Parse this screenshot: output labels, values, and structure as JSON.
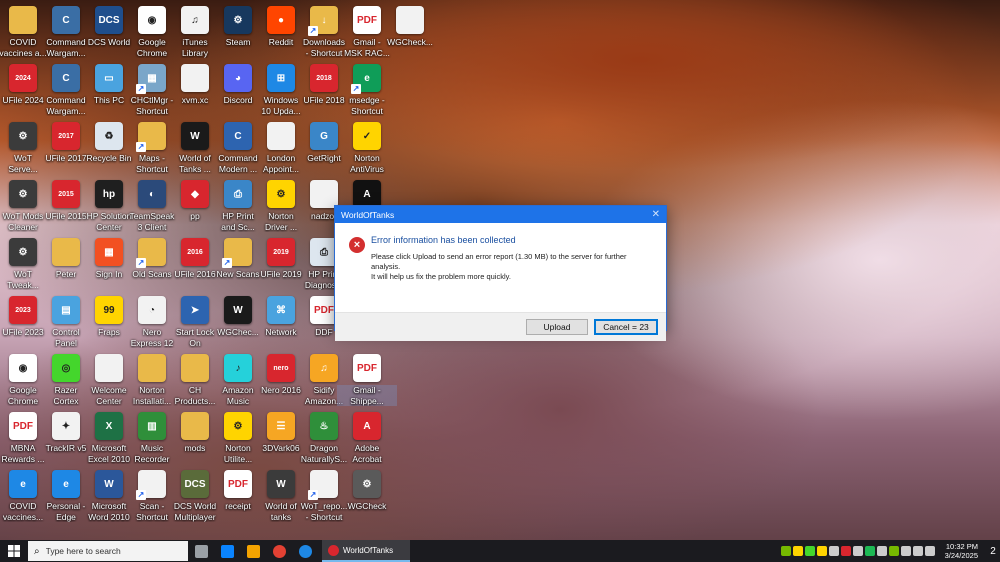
{
  "desktop_icons": [
    {
      "label": "COVID\nvaccines a...",
      "color": "#e9b949",
      "glyph": "",
      "shortcut": false,
      "icon": "folder-icon"
    },
    {
      "label": "Command\nWargam...",
      "color": "#3a6ea5",
      "glyph": "C",
      "shortcut": false,
      "icon": "command-app-icon"
    },
    {
      "label": "DCS World",
      "color": "#1f4e8c",
      "glyph": "DCS",
      "shortcut": false,
      "icon": "dcs-icon"
    },
    {
      "label": "Google\nChrome",
      "color": "#ffffff",
      "glyph": "◉",
      "shortcut": false,
      "icon": "chrome-icon"
    },
    {
      "label": "iTunes\nLibrary",
      "color": "#f2f2f2",
      "glyph": "♫",
      "shortcut": false,
      "icon": "itunes-file-icon"
    },
    {
      "label": "Steam",
      "color": "#17385e",
      "glyph": "⚙",
      "shortcut": false,
      "icon": "steam-icon"
    },
    {
      "label": "Reddit",
      "color": "#ff4500",
      "glyph": "●",
      "shortcut": false,
      "icon": "reddit-icon"
    },
    {
      "label": "Downloads\n- Shortcut",
      "color": "#e9b949",
      "glyph": "↓",
      "shortcut": true,
      "icon": "downloads-folder-icon"
    },
    {
      "label": "Gmail -\nMSK RAC...",
      "color": "#ffffff",
      "glyph": "PDF",
      "shortcut": false,
      "icon": "pdf-icon"
    },
    {
      "label": "WGCheck...",
      "color": "#f2f2f2",
      "glyph": "",
      "shortcut": false,
      "icon": "text-file-icon"
    },
    {
      "label": "UFile 2024",
      "color": "#d8262e",
      "glyph": "2024",
      "shortcut": false,
      "icon": "ufile-icon"
    },
    {
      "label": "Command\nWargam...",
      "color": "#3a6ea5",
      "glyph": "C",
      "shortcut": false,
      "icon": "command-app-icon"
    },
    {
      "label": "This PC",
      "color": "#4aa3df",
      "glyph": "▭",
      "shortcut": false,
      "icon": "computer-icon"
    },
    {
      "label": "CHCtlMgr -\nShortcut",
      "color": "#7aa6c9",
      "glyph": "▦",
      "shortcut": true,
      "icon": "chctlmgr-icon"
    },
    {
      "label": "xvm.xc",
      "color": "#f2f2f2",
      "glyph": "",
      "shortcut": false,
      "icon": "text-file-icon"
    },
    {
      "label": "Discord",
      "color": "#5865f2",
      "glyph": "◕",
      "shortcut": false,
      "icon": "discord-icon"
    },
    {
      "label": "Windows\n10 Upda...",
      "color": "#1e88e5",
      "glyph": "⊞",
      "shortcut": false,
      "icon": "windows-icon"
    },
    {
      "label": "UFile 2018",
      "color": "#d8262e",
      "glyph": "2018",
      "shortcut": false,
      "icon": "ufile-icon"
    },
    {
      "label": "msedge -\nShortcut",
      "color": "#0f9d58",
      "glyph": "e",
      "shortcut": true,
      "icon": "edge-icon"
    },
    {
      "label": "WoT\nServe...",
      "color": "#3b3b3b",
      "glyph": "⚙",
      "shortcut": false,
      "icon": "wot-icon"
    },
    {
      "label": "UFile 2017",
      "color": "#d8262e",
      "glyph": "2017",
      "shortcut": false,
      "icon": "ufile-icon"
    },
    {
      "label": "Recycle Bin",
      "color": "#dde6ef",
      "glyph": "♻",
      "shortcut": false,
      "icon": "recycle-bin-icon"
    },
    {
      "label": "Maps -\nShortcut",
      "color": "#e9b949",
      "glyph": "",
      "shortcut": true,
      "icon": "folder-icon"
    },
    {
      "label": "World of\nTanks ...",
      "color": "#1a1a1a",
      "glyph": "W",
      "shortcut": false,
      "icon": "wot-game-icon"
    },
    {
      "label": "Command\nModern ...",
      "color": "#2d64b0",
      "glyph": "C",
      "shortcut": false,
      "icon": "command-modern-icon"
    },
    {
      "label": "London\nAppoint...",
      "color": "#f2f2f2",
      "glyph": "",
      "shortcut": false,
      "icon": "text-file-icon"
    },
    {
      "label": "GetRight",
      "color": "#3a86c8",
      "glyph": "G",
      "shortcut": false,
      "icon": "getright-icon"
    },
    {
      "label": "Norton\nAntiVirus",
      "color": "#ffd400",
      "glyph": "✓",
      "shortcut": false,
      "icon": "norton-icon"
    },
    {
      "label": "WoT Mods\nCleaner",
      "color": "#3b3b3b",
      "glyph": "⚙",
      "shortcut": false,
      "icon": "wot-icon"
    },
    {
      "label": "UFile 2015",
      "color": "#d8262e",
      "glyph": "2015",
      "shortcut": false,
      "icon": "ufile-icon"
    },
    {
      "label": "HP Solution\nCenter",
      "color": "#1f1f1f",
      "glyph": "hp",
      "shortcut": false,
      "icon": "hp-icon"
    },
    {
      "label": "TeamSpeak\n3 Client",
      "color": "#2b4a7a",
      "glyph": "◐",
      "shortcut": false,
      "icon": "teamspeak-icon"
    },
    {
      "label": "pp",
      "color": "#d8262e",
      "glyph": "◆",
      "shortcut": false,
      "icon": "pp-icon"
    },
    {
      "label": "HP Print\nand Sc...",
      "color": "#3a86c8",
      "glyph": "⎙",
      "shortcut": false,
      "icon": "hp-print-icon"
    },
    {
      "label": "Norton\nDriver ...",
      "color": "#ffd400",
      "glyph": "⚙",
      "shortcut": false,
      "icon": "norton-driver-icon"
    },
    {
      "label": "nadzor",
      "color": "#f2f2f2",
      "glyph": "",
      "shortcut": false,
      "icon": "text-file-icon"
    },
    {
      "label": "",
      "color": "#111111",
      "glyph": "A",
      "shortcut": false,
      "icon": "slain-icon"
    },
    {
      "label": "WoT\nTweak...",
      "color": "#3b3b3b",
      "glyph": "⚙",
      "shortcut": false,
      "icon": "wot-icon"
    },
    {
      "label": "Peter",
      "color": "#e9b949",
      "glyph": "",
      "shortcut": false,
      "icon": "folder-icon"
    },
    {
      "label": "Sign In",
      "color": "#f25022",
      "glyph": "▦",
      "shortcut": false,
      "icon": "microsoft-icon"
    },
    {
      "label": "Old Scans",
      "color": "#e9b949",
      "glyph": "",
      "shortcut": true,
      "icon": "folder-icon"
    },
    {
      "label": "UFile 2016",
      "color": "#d8262e",
      "glyph": "2016",
      "shortcut": false,
      "icon": "ufile-icon"
    },
    {
      "label": "New Scans",
      "color": "#e9b949",
      "glyph": "",
      "shortcut": true,
      "icon": "folder-icon"
    },
    {
      "label": "UFile 2019",
      "color": "#d8262e",
      "glyph": "2019",
      "shortcut": false,
      "icon": "ufile-icon"
    },
    {
      "label": "HP Print\nDiagnos...",
      "color": "#dde6ef",
      "glyph": "⎙",
      "shortcut": false,
      "icon": "hp-diag-icon"
    },
    {
      "label": "UFile 2023",
      "color": "#d8262e",
      "glyph": "2023",
      "shortcut": false,
      "icon": "ufile-icon"
    },
    {
      "label": "Control\nPanel",
      "color": "#4aa3df",
      "glyph": "▤",
      "shortcut": false,
      "icon": "control-panel-icon"
    },
    {
      "label": "Fraps",
      "color": "#ffd400",
      "glyph": "99",
      "shortcut": false,
      "icon": "fraps-icon"
    },
    {
      "label": "Nero\nExpress 12",
      "color": "#f2f2f2",
      "glyph": "◔",
      "shortcut": false,
      "icon": "nero-express-icon"
    },
    {
      "label": "Start Lock\nOn",
      "color": "#2d64b0",
      "glyph": "➤",
      "shortcut": false,
      "icon": "start-lock-icon"
    },
    {
      "label": "WGChec...",
      "color": "#1a1a1a",
      "glyph": "W",
      "shortcut": false,
      "icon": "wgcheck-icon"
    },
    {
      "label": "Network",
      "color": "#4aa3df",
      "glyph": "⌘",
      "shortcut": false,
      "icon": "network-icon"
    },
    {
      "label": "DDF",
      "color": "#ffffff",
      "glyph": "PDF",
      "shortcut": false,
      "icon": "pdf-icon"
    },
    {
      "label": "Google\nChrome",
      "color": "#ffffff",
      "glyph": "◉",
      "shortcut": false,
      "icon": "chrome-icon"
    },
    {
      "label": "Razer\nCortex",
      "color": "#44d62c",
      "glyph": "◎",
      "shortcut": false,
      "icon": "razer-icon"
    },
    {
      "label": "Welcome\nCenter",
      "color": "#f2f2f2",
      "glyph": "",
      "shortcut": false,
      "icon": "text-file-icon"
    },
    {
      "label": "Norton\nInstallati...",
      "color": "#e9b949",
      "glyph": "",
      "shortcut": false,
      "icon": "folder-icon"
    },
    {
      "label": "CH\nProducts...",
      "color": "#e9b949",
      "glyph": "",
      "shortcut": false,
      "icon": "folder-icon"
    },
    {
      "label": "Amazon\nMusic",
      "color": "#25d1da",
      "glyph": "♪",
      "shortcut": false,
      "icon": "amazon-music-icon"
    },
    {
      "label": "Nero 2016",
      "color": "#d8262e",
      "glyph": "nero",
      "shortcut": false,
      "icon": "nero-icon"
    },
    {
      "label": "Sidify\nAmazon...",
      "color": "#f6a623",
      "glyph": "♫",
      "shortcut": false,
      "icon": "sidify-icon"
    },
    {
      "label": "Gmail -\nShippe...",
      "color": "#ffffff",
      "glyph": "PDF",
      "shortcut": false,
      "icon": "pdf-icon"
    },
    {
      "label": "MBNA\nRewards ...",
      "color": "#ffffff",
      "glyph": "PDF",
      "shortcut": false,
      "icon": "pdf-icon"
    },
    {
      "label": "TrackIR v5",
      "color": "#f2f2f2",
      "glyph": "✦",
      "shortcut": false,
      "icon": "trackir-icon"
    },
    {
      "label": "Microsoft\nExcel 2010",
      "color": "#1e7145",
      "glyph": "X",
      "shortcut": false,
      "icon": "excel-icon"
    },
    {
      "label": "Music\nRecorder",
      "color": "#2f8f3a",
      "glyph": "▥",
      "shortcut": false,
      "icon": "music-recorder-icon"
    },
    {
      "label": "mods",
      "color": "#e9b949",
      "glyph": "",
      "shortcut": false,
      "icon": "folder-icon"
    },
    {
      "label": "Norton\nUtilite...",
      "color": "#ffd400",
      "glyph": "⚙",
      "shortcut": false,
      "icon": "norton-utilities-icon"
    },
    {
      "label": "3DVark06",
      "color": "#f6a623",
      "glyph": "☰",
      "shortcut": false,
      "icon": "3dvark-icon"
    },
    {
      "label": "Dragon\nNaturallyS...",
      "color": "#2f8f3a",
      "glyph": "♨",
      "shortcut": false,
      "icon": "dragon-icon"
    },
    {
      "label": "Adobe\nAcrobat",
      "color": "#d8262e",
      "glyph": "A",
      "shortcut": false,
      "icon": "acrobat-icon"
    },
    {
      "label": "COVID\nvaccines...",
      "color": "#1e88e5",
      "glyph": "e",
      "shortcut": false,
      "icon": "edge-icon"
    },
    {
      "label": "Personal -\nEdge",
      "color": "#1e88e5",
      "glyph": "e",
      "shortcut": false,
      "icon": "edge-icon"
    },
    {
      "label": "Microsoft\nWord 2010",
      "color": "#2b579a",
      "glyph": "W",
      "shortcut": false,
      "icon": "word-icon"
    },
    {
      "label": "Scan -\nShortcut",
      "color": "#f2f2f2",
      "glyph": "",
      "shortcut": true,
      "icon": "text-file-icon"
    },
    {
      "label": "DCS World\nMultiplayer",
      "color": "#5a6b3a",
      "glyph": "DCS",
      "shortcut": false,
      "icon": "dcs-icon"
    },
    {
      "label": "receipt",
      "color": "#ffffff",
      "glyph": "PDF",
      "shortcut": false,
      "icon": "pdf-icon"
    },
    {
      "label": "World of\ntanks",
      "color": "#3b3b3b",
      "glyph": "W",
      "shortcut": false,
      "icon": "wot-game-icon"
    },
    {
      "label": "WoT_repo...\n- Shortcut",
      "color": "#f2f2f2",
      "glyph": "",
      "shortcut": true,
      "icon": "text-file-icon"
    },
    {
      "label": "WGCheck",
      "color": "#5a5a5a",
      "glyph": "⚙",
      "shortcut": false,
      "icon": "wgcheck-icon"
    }
  ],
  "dialog": {
    "title": "WorldOfTanks",
    "close_glyph": "✕",
    "heading": "Error information has been collected",
    "message_line1": "Please click Upload to send an error report (1.30 MB) to the server for further analysis.",
    "message_line2": "It will help us fix the problem more quickly.",
    "upload_label": "Upload",
    "cancel_label": "Cancel = 23"
  },
  "taskbar": {
    "search_placeholder": "Type here to search",
    "active_window_label": "WorldOfTanks",
    "time": "10:32 PM",
    "date": "3/24/2025",
    "notification_count": "2",
    "pinned": [
      {
        "icon": "task-view-icon",
        "color": "#9aa0a6"
      },
      {
        "icon": "store-icon",
        "color": "#0a84ff"
      },
      {
        "icon": "media-player-icon",
        "color": "#f4a300"
      },
      {
        "icon": "chrome-icon",
        "color": "#e34133"
      },
      {
        "icon": "edge-icon",
        "color": "#1e88e5"
      }
    ],
    "tray": [
      {
        "icon": "nvidia-icon",
        "color": "#76b900"
      },
      {
        "icon": "norton-tray-icon",
        "color": "#ffd400"
      },
      {
        "icon": "razer-tray-icon",
        "color": "#44d62c"
      },
      {
        "icon": "norton-tray-icon",
        "color": "#ffd400"
      },
      {
        "icon": "usb-icon",
        "color": "#cccccc"
      },
      {
        "icon": "wot-tray-icon",
        "color": "#d8262e"
      },
      {
        "icon": "security-icon",
        "color": "#cccccc"
      },
      {
        "icon": "spotify-icon",
        "color": "#1db954"
      },
      {
        "icon": "onedrive-icon",
        "color": "#cccccc"
      },
      {
        "icon": "nvidia-icon",
        "color": "#76b900"
      },
      {
        "icon": "volume-icon",
        "color": "#cccccc"
      },
      {
        "icon": "network-icon",
        "color": "#cccccc"
      },
      {
        "icon": "language-icon",
        "color": "#cccccc"
      }
    ]
  }
}
